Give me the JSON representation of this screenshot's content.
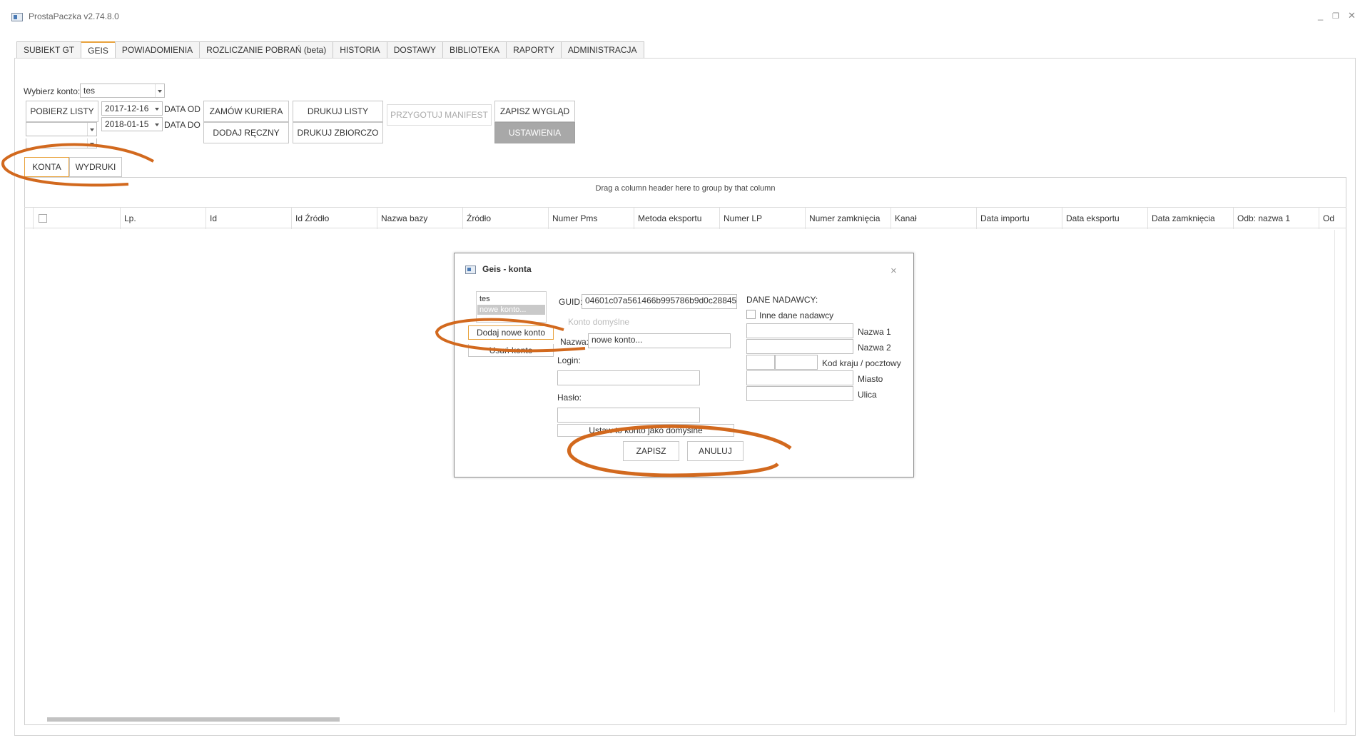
{
  "window": {
    "title": "ProstaPaczka v2.74.8.0",
    "minimize": "_",
    "restore": "❐",
    "close": "✕"
  },
  "tabs": [
    {
      "label": "SUBIEKT GT",
      "active": false
    },
    {
      "label": "GEIS",
      "active": true
    },
    {
      "label": "POWIADOMIENIA",
      "active": false
    },
    {
      "label": "ROZLICZANIE POBRAŃ (beta)",
      "active": false
    },
    {
      "label": "HISTORIA",
      "active": false
    },
    {
      "label": "DOSTAWY",
      "active": false
    },
    {
      "label": "BIBLIOTEKA",
      "active": false
    },
    {
      "label": "RAPORTY",
      "active": false
    },
    {
      "label": "ADMINISTRACJA",
      "active": false
    }
  ],
  "toolbar": {
    "account_label": "Wybierz konto:",
    "account_value": "tes",
    "fetch_button": "POBIERZ LISTY",
    "date_from_value": "2017-12-16",
    "date_from_label": "DATA OD",
    "date_to_value": "2018-01-15",
    "date_to_label": "DATA DO",
    "order_courier": "ZAMÓW KURIERA",
    "add_manual": "DODAJ RĘCZNY",
    "print_lists": "DRUKUJ LISTY",
    "print_bulk": "DRUKUJ ZBIORCZO",
    "prepare_manifest": "PRZYGOTUJ MANIFEST",
    "save_layout": "ZAPISZ WYGLĄD",
    "settings": "USTAWIENIA"
  },
  "subtabs": {
    "accounts": "KONTA",
    "printouts": "WYDRUKI"
  },
  "grid": {
    "group_hint": "Drag a column header here to group by that column",
    "columns": [
      "Lp.",
      "Id",
      "Id Źródło",
      "Nazwa bazy",
      "Źródło",
      "Numer Pms",
      "Metoda eksportu",
      "Numer LP",
      "Numer zamknięcia",
      "Kanał",
      "Data importu",
      "Data eksportu",
      "Data zamknięcia",
      "Odb: nazwa 1",
      "Od"
    ]
  },
  "dialog": {
    "title": "Geis - konta",
    "close": "×",
    "accounts": [
      {
        "name": "tes",
        "selected": false
      },
      {
        "name": "nowe konto...",
        "selected": true
      }
    ],
    "add_account": "Dodaj nowe konto",
    "remove_account": "Usuń konto",
    "guid_label": "GUID:",
    "guid_value": "04601c07a561466b995786b9d0c28845",
    "default_account_label": "Konto domyślne",
    "name_label": "Nazwa:",
    "name_value": "nowe konto...",
    "login_label": "Login:",
    "login_value": "",
    "password_label": "Hasło:",
    "password_value": "",
    "set_default": "Ustaw to konto jako domyślne",
    "save": "ZAPISZ",
    "cancel": "ANULUJ",
    "sender": {
      "header": "DANE NADAWCY:",
      "other_sender": "Inne dane nadawcy",
      "name1": "Nazwa 1",
      "name2": "Nazwa 2",
      "country_postal": "Kod kraju / pocztowy",
      "city": "Miasto",
      "street": "Ulica"
    }
  },
  "colors": {
    "accent_orange": "#d2691e",
    "active_tab_border": "#e8a23c",
    "settings_bg": "#a8a8a8"
  }
}
